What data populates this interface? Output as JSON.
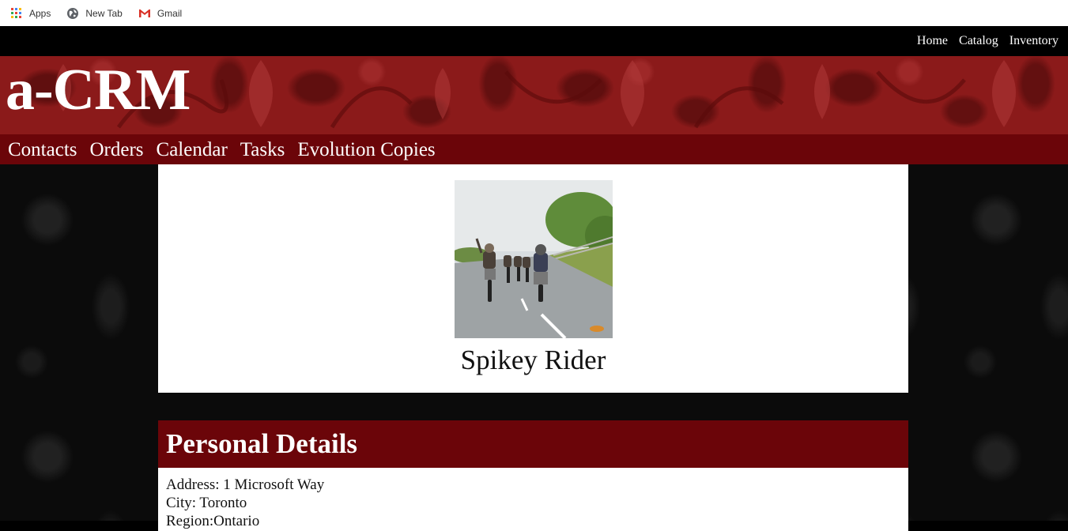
{
  "bookmarks": [
    {
      "label": "Apps",
      "icon": "apps-grid-icon"
    },
    {
      "label": "New Tab",
      "icon": "globe-icon"
    },
    {
      "label": "Gmail",
      "icon": "gmail-icon"
    }
  ],
  "top_nav": [
    "Home",
    "Catalog",
    "Inventory"
  ],
  "site": {
    "logo": "a-CRM"
  },
  "main_nav": [
    "Contacts",
    "Orders",
    "Calendar",
    "Tasks",
    "Evolution Copies"
  ],
  "profile": {
    "name": "Spikey Rider",
    "photo_icon": "motorcycle-riders-photo"
  },
  "personal_details": {
    "heading": "Personal Details",
    "address": "Address: 1 Microsoft Way",
    "city": "City: Toronto",
    "region": "Region:Ontario"
  },
  "colors": {
    "banner_red": "#8b1a1a",
    "nav_maroon": "#6b0509",
    "top_nav_bg": "#000000"
  }
}
